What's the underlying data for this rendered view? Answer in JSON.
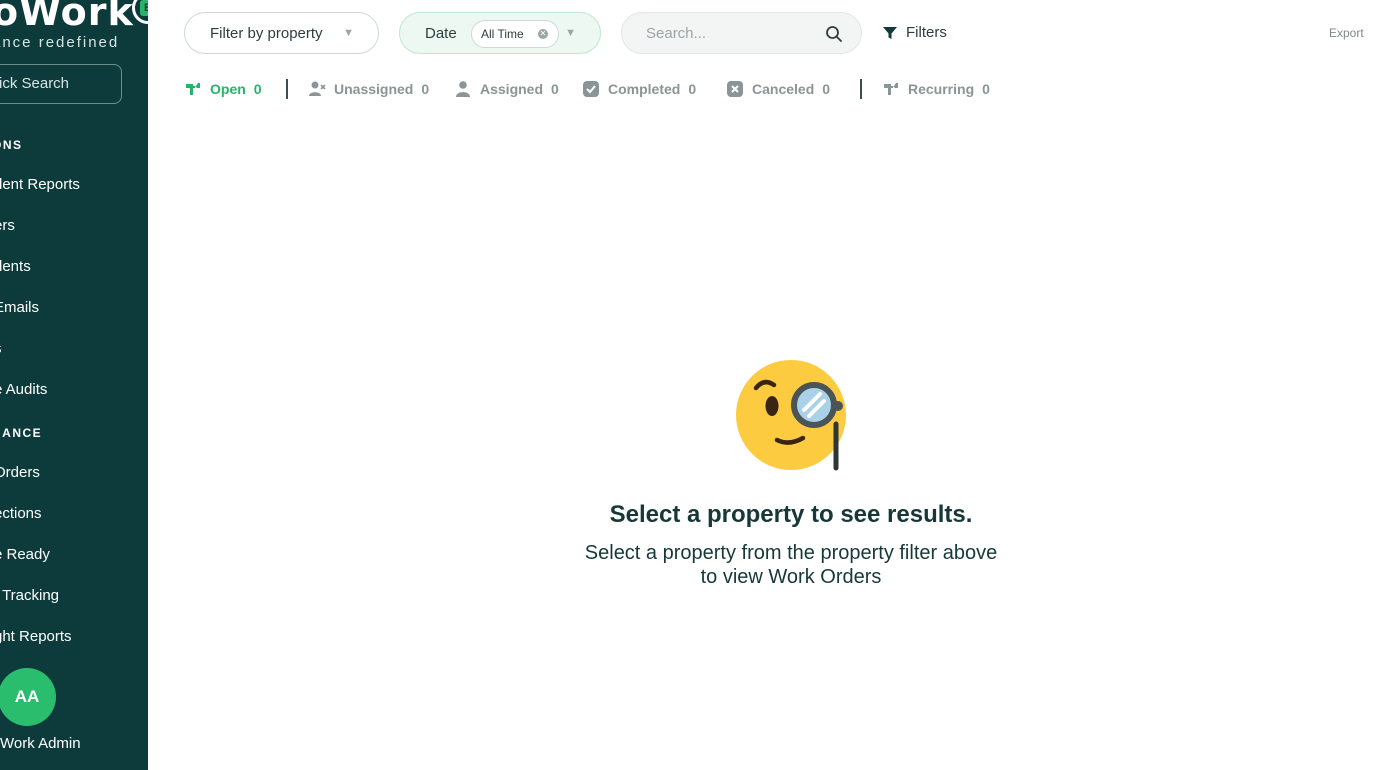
{
  "sidebar": {
    "logo_text": "oWork",
    "logo_badge": "B",
    "tagline": "ance redefined",
    "quick_search": "ick Search",
    "sections": [
      {
        "label": "ONS"
      },
      {
        "label": "NANCE"
      }
    ],
    "items": [
      {
        "label": "dent Reports"
      },
      {
        "label": "ers"
      },
      {
        "label": "dents"
      },
      {
        "label": "Emails"
      },
      {
        "label": "s"
      },
      {
        "label": "e Audits"
      },
      {
        "label": "Orders"
      },
      {
        "label": "ections"
      },
      {
        "label": "e Ready"
      },
      {
        "label": "t Tracking"
      },
      {
        "label": "ght Reports"
      }
    ],
    "avatar_initials": "AA",
    "user_name": "Work Admin"
  },
  "toolbar": {
    "property_filter": "Filter by property",
    "date_label": "Date",
    "date_value": "All Time",
    "search_placeholder": "Search...",
    "filters_label": "Filters",
    "export_label": "Export"
  },
  "tabs": [
    {
      "label": "Open",
      "count": "0",
      "icon": "wrench-icon"
    },
    {
      "label": "Unassigned",
      "count": "0",
      "icon": "user-remove-icon"
    },
    {
      "label": "Assigned",
      "count": "0",
      "icon": "user-icon"
    },
    {
      "label": "Completed",
      "count": "0",
      "icon": "check-box-icon"
    },
    {
      "label": "Canceled",
      "count": "0",
      "icon": "x-box-icon"
    },
    {
      "label": "Recurring",
      "count": "0",
      "icon": "recurring-icon"
    }
  ],
  "empty_state": {
    "icon": "monocle-face-icon",
    "title": "Select a property to see results.",
    "line1": "Select a property from the property filter above",
    "line2": "to view Work Orders"
  },
  "colors": {
    "sidebar_bg": "#0d3b3b",
    "accent": "#27b36a",
    "muted": "#8a9595"
  }
}
